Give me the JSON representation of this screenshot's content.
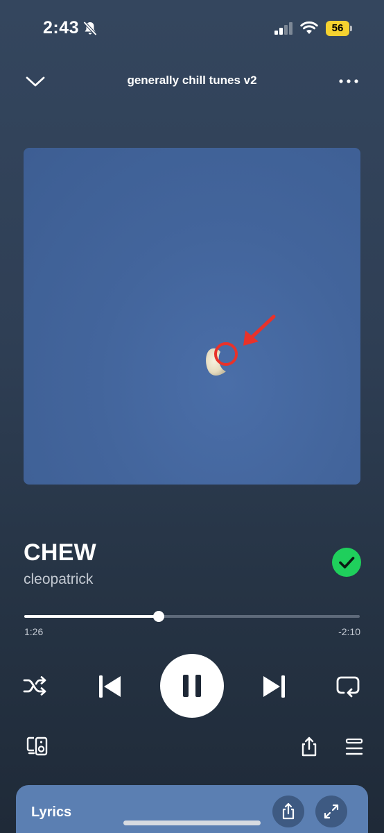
{
  "status_bar": {
    "time": "2:43",
    "battery_level": "56",
    "icons": [
      "bell-slash-icon",
      "signal-icon",
      "wifi-icon",
      "battery-icon"
    ]
  },
  "header": {
    "title": "generally chill tunes v2",
    "collapse_icon": "chevron-down-icon",
    "menu_icon": "more-icon"
  },
  "track": {
    "title": "CHEW",
    "artist": "cleopatrick",
    "saved": true
  },
  "playback": {
    "elapsed": "1:26",
    "remaining": "-2:10",
    "progress_fraction": 0.4,
    "is_playing": true
  },
  "lyrics": {
    "label": "Lyrics"
  },
  "colors": {
    "saved_green": "#1fcf5c",
    "battery_yellow": "#f5d230",
    "lyrics_card": "#5b7fb2",
    "annotation_red": "#e8322a"
  }
}
